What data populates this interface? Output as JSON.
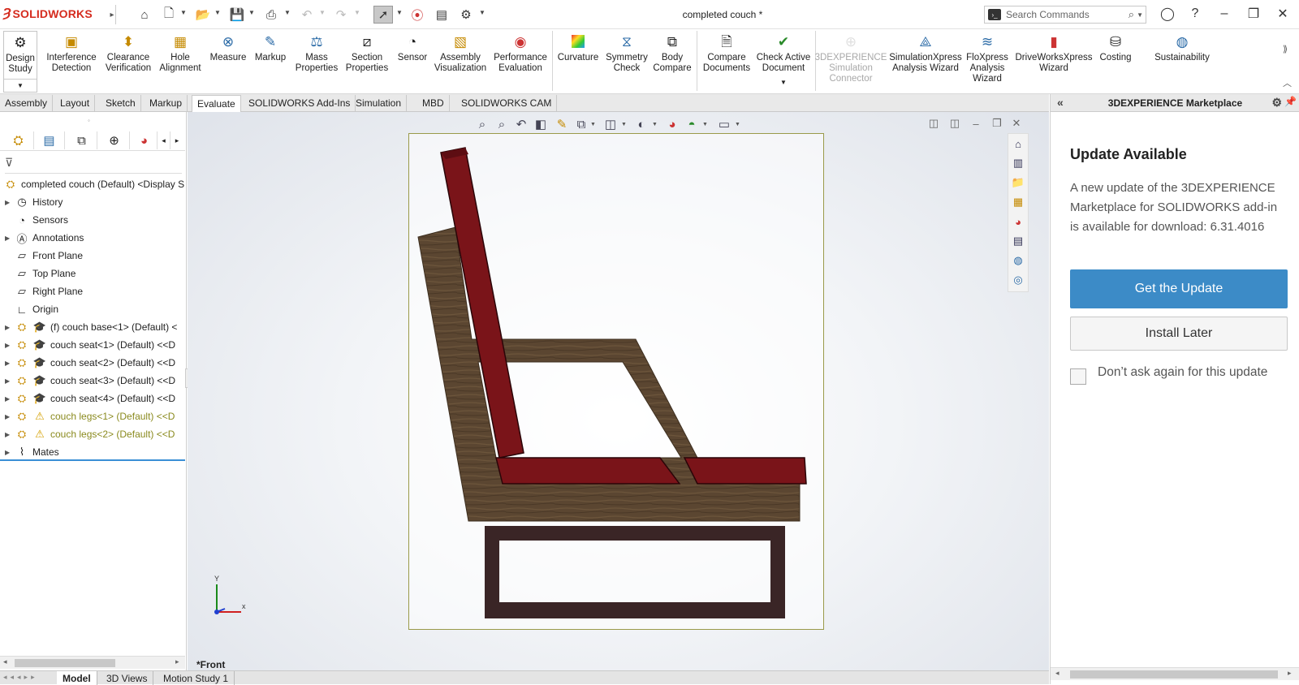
{
  "app": {
    "brand": "SOLIDWORKS",
    "doc_title": "completed couch *"
  },
  "search": {
    "placeholder": "Search Commands"
  },
  "ribbon": {
    "design_study": "Design Study",
    "interference": "Interference Detection",
    "clearance": "Clearance Verification",
    "hole": "Hole Alignment",
    "measure": "Measure",
    "markup": "Markup",
    "mass": "Mass Properties",
    "section": "Section Properties",
    "sensor": "Sensor",
    "assembly_vis": "Assembly Visualization",
    "performance": "Performance Evaluation",
    "curvature": "Curvature",
    "symmetry": "Symmetry Check",
    "body_compare": "Body Compare",
    "compare_docs": "Compare Documents",
    "check_active": "Check Active Document",
    "sim_connector": "3DEXPERIENCE Simulation Connector",
    "simxpress": "SimulationXpress Analysis Wizard",
    "floxpress": "FloXpress Analysis Wizard",
    "driveworks": "DriveWorksXpress Wizard",
    "costing": "Costing",
    "sustainability": "Sustainability"
  },
  "tabs": [
    "Assembly",
    "Layout",
    "Sketch",
    "Markup",
    "Evaluate",
    "SOLIDWORKS Add-Ins",
    "Simulation",
    "MBD",
    "SOLIDWORKS CAM"
  ],
  "tree": {
    "root": "completed couch (Default) <Display S",
    "items": [
      {
        "label": "History"
      },
      {
        "label": "Sensors"
      },
      {
        "label": "Annotations"
      },
      {
        "label": "Front Plane"
      },
      {
        "label": "Top Plane"
      },
      {
        "label": "Right Plane"
      },
      {
        "label": "Origin"
      },
      {
        "label": "(f) couch base<1> (Default) <"
      },
      {
        "label": "couch seat<1> (Default) <<D"
      },
      {
        "label": "couch seat<2> (Default) <<D"
      },
      {
        "label": "couch seat<3> (Default) <<D"
      },
      {
        "label": "couch seat<4> (Default) <<D"
      },
      {
        "label": "couch legs<1> (Default) <<D"
      },
      {
        "label": "couch legs<2> (Default) <<D"
      },
      {
        "label": "Mates"
      }
    ]
  },
  "viewport": {
    "view_label": "*Front",
    "axis_x": "x",
    "axis_y": "Y"
  },
  "bottom_tabs": [
    "Model",
    "3D Views",
    "Motion Study 1"
  ],
  "marketplace": {
    "header": "3DEXPERIENCE Marketplace",
    "title": "Update Available",
    "message": "A new update of the 3DEXPERIENCE Marketplace for SOLIDWORKS add-in is available for download: 6.31.4016",
    "primary_button": "Get the Update",
    "secondary_button": "Install Later",
    "checkbox_label": "Don’t ask again for this update"
  },
  "colors": {
    "accent": "#3c8bc7",
    "brand": "#d52b1e",
    "seat": "#7a1419",
    "wood": "#5a4530",
    "legs": "#3a2424"
  }
}
